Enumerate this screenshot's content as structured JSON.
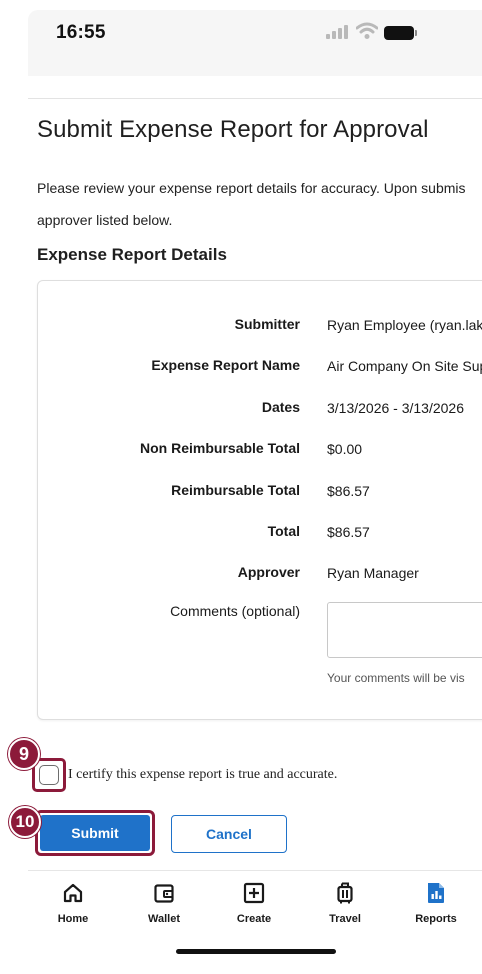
{
  "status_bar": {
    "time": "16:55"
  },
  "page": {
    "title": "Submit Expense Report for Approval",
    "intro_line1": "Please review your expense report details for accuracy. Upon submis",
    "intro_line2": "approver listed below.",
    "section_title": "Expense Report Details"
  },
  "details": {
    "submitter_label": "Submitter",
    "submitter_value": "Ryan Employee (ryan.lak",
    "report_name_label": "Expense Report Name",
    "report_name_value": "Air Company On Site Sup",
    "dates_label": "Dates",
    "dates_value": "3/13/2026 - 3/13/2026",
    "non_reimb_label": "Non Reimbursable Total",
    "non_reimb_value": "$0.00",
    "reimb_label": "Reimbursable Total",
    "reimb_value": "$86.57",
    "total_label": "Total",
    "total_value": "$86.57",
    "approver_label": "Approver",
    "approver_value": "Ryan Manager",
    "comments_label": "Comments (optional)",
    "comments_value": "",
    "comments_hint": "Your comments will be vis"
  },
  "certify": {
    "label": "I certify this expense report is true and accurate.",
    "checked": false
  },
  "actions": {
    "submit_label": "Submit",
    "cancel_label": "Cancel"
  },
  "callouts": {
    "step_checkbox": "9",
    "step_submit": "10",
    "color": "#8c1a3a"
  },
  "tab_bar": {
    "items": [
      {
        "label": "Home",
        "icon": "home-icon"
      },
      {
        "label": "Wallet",
        "icon": "wallet-icon"
      },
      {
        "label": "Create",
        "icon": "plus-square-icon"
      },
      {
        "label": "Travel",
        "icon": "luggage-icon"
      },
      {
        "label": "Reports",
        "icon": "reports-icon",
        "active": true
      }
    ],
    "accent": "#1f72c9"
  }
}
